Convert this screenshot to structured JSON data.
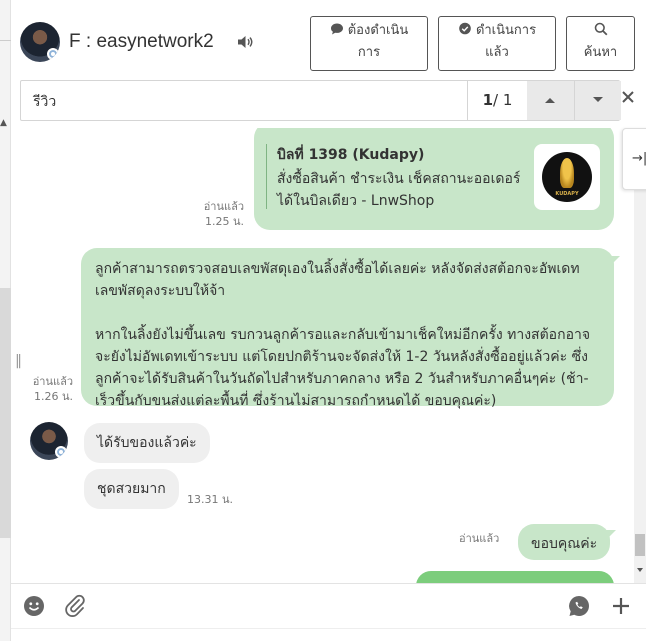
{
  "header": {
    "contact_name": "F : easynetwork2",
    "buttons": [
      {
        "label": "ต้องดำเนินการ",
        "icon": "chat-bubble-icon"
      },
      {
        "label": "ดำเนินการแล้ว",
        "icon": "check-bubble-icon"
      },
      {
        "label": "ค้นหา",
        "icon": "search-icon"
      }
    ]
  },
  "search": {
    "query": "รีวิว",
    "current": "1",
    "total": "/ 1"
  },
  "messages": [
    {
      "type": "outgoing-card",
      "status": "อ่านแล้ว",
      "time": "1.25 น.",
      "title": "บิลที่ 1398 (Kudapy)",
      "description": "สั่งซื้อสินค้า ชำระเงิน เช็คสถานะออเดอร์ได้ในบิลเดียว - LnwShop",
      "logo_text": "KUDAPY"
    },
    {
      "type": "outgoing-text",
      "status": "อ่านแล้ว",
      "time": "1.26 น.",
      "paragraph1": "ลูกค้าสามารถตรวจสอบเลขพัสดุเองในลิ้งสั่งซื้อได้เลยค่ะ หลังจัดส่งสต้อกจะอัพเดทเลขพัสดุลงระบบให้จ้า",
      "paragraph2": "หากในลิ้งยังไม่ขึ้นเลข รบกวนลูกค้ารอและกลับเข้ามาเช็คใหม่อีกครั้ง ทางสต้อกอาจจะยังไม่อัพเดทเข้าระบบ แต่โดยปกติร้านจะจัดส่งให้ 1-2 วันหลังสั่งซื้ออยู่แล้วค่ะ ซึ่งลูกค้าจะได้รับสินค้าในวันถัดไปสำหรับภาคกลาง หรือ 2 วันสำหรับภาคอื่นๆค่ะ (ช้า-เร็วขึ้นกับขนส่งแต่ละพื้นที่ ซึ่งร้านไม่สามารถกำหนดได้ ขอบคุณค่ะ)"
    },
    {
      "type": "incoming-text",
      "text": "ได้รับของแล้วค่ะ"
    },
    {
      "type": "incoming-text",
      "text": "ชุดสวยมาก",
      "time": "13.31 น."
    },
    {
      "type": "outgoing-text",
      "status": "อ่านแล้ว",
      "text": "ขอบคุณค่ะ"
    }
  ],
  "colors": {
    "outgoing_bubble": "#c8e6c9",
    "outgoing_bubble_dark": "#7ccd7c",
    "incoming_bubble": "#efefef"
  }
}
